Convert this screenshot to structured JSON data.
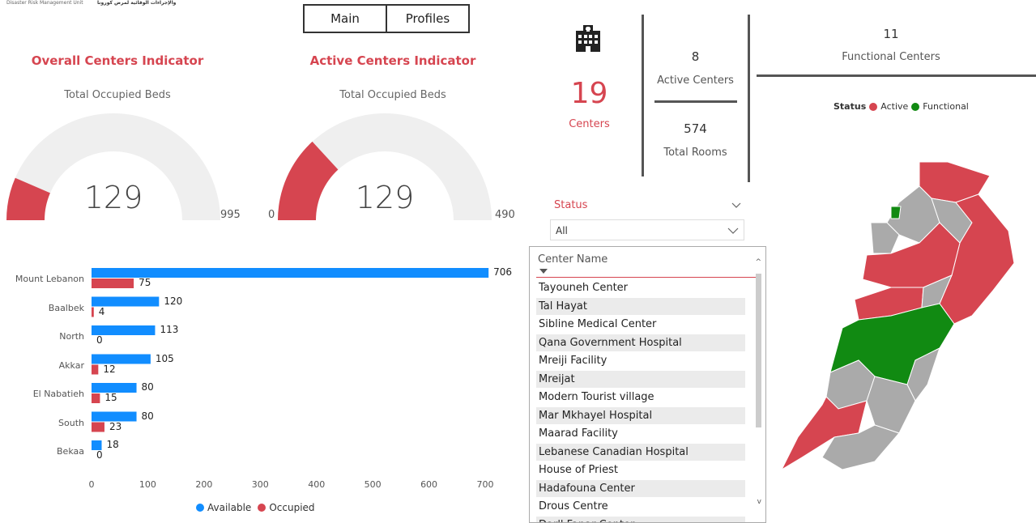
{
  "header": {
    "logo_line1": "Disaster Risk Management Unit",
    "logo_line2": "والإجراءات الوقائية لمرض كورونا"
  },
  "nav": {
    "main_label": "Main",
    "profiles_label": "Profiles"
  },
  "overall": {
    "title": "Overall Centers Indicator",
    "subtitle": "Total Occupied Beds",
    "value": "129",
    "max_label": "995",
    "fraction": 0.1296
  },
  "active": {
    "title": "Active Centers Indicator",
    "subtitle": "Total Occupied Beds",
    "value": "129",
    "min_label": "0",
    "max_label": "490",
    "fraction": 0.263
  },
  "kpis": {
    "centers_value": "19",
    "centers_label": "Centers",
    "active_value": "8",
    "active_label": "Active Centers",
    "rooms_value": "574",
    "rooms_label": "Total Rooms",
    "functional_value": "11",
    "functional_label": "Functional Centers"
  },
  "map_legend": {
    "title": "Status",
    "items": [
      {
        "label": "Active",
        "color": "#d64550"
      },
      {
        "label": "Functional",
        "color": "#118a12"
      }
    ]
  },
  "slicer": {
    "title": "Status",
    "value": "All"
  },
  "center_table": {
    "header": "Center Name",
    "rows": [
      "Tayouneh Center",
      "Tal Hayat",
      "Sibline Medical Center",
      "Qana Government Hospital",
      "Mreiji Facility",
      "Mreijat",
      "Modern Tourist village",
      "Mar Mkhayel Hospital",
      "Maarad Facility",
      "Lebanese Canadian Hospital",
      "House of Priest",
      "Hadafouna Center",
      "Drous Centre",
      "Dar'l Fanar Center"
    ]
  },
  "chart_data": {
    "type": "bar",
    "orientation": "horizontal",
    "categories": [
      "Mount Lebanon",
      "Baalbek",
      "North",
      "Akkar",
      "El Nabatieh",
      "South",
      "Bekaa"
    ],
    "series": [
      {
        "name": "Available",
        "color": "#118dff",
        "values": [
          706,
          120,
          113,
          105,
          80,
          80,
          18
        ]
      },
      {
        "name": "Occupied",
        "color": "#d64550",
        "values": [
          75,
          4,
          0,
          12,
          15,
          23,
          0
        ]
      }
    ],
    "xticks": [
      "0",
      "100",
      "200",
      "300",
      "400",
      "500",
      "600",
      "700"
    ],
    "xlim": [
      0,
      700
    ],
    "legend": "bottom-center",
    "grid": false
  }
}
